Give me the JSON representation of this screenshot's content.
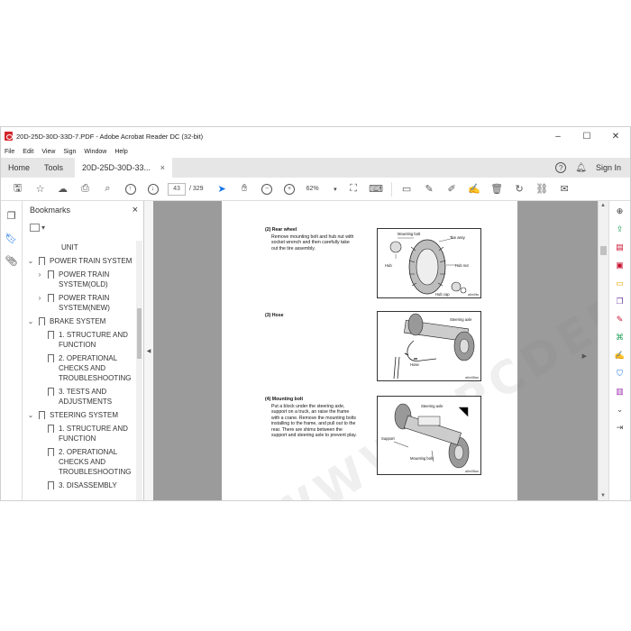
{
  "window": {
    "title": "20D-25D-30D-33D-7.PDF - Adobe Acrobat Reader DC (32-bit)",
    "controls": [
      "–",
      "☐",
      "✕"
    ]
  },
  "menu": [
    "File",
    "Edit",
    "View",
    "Sign",
    "Window",
    "Help"
  ],
  "tabs": {
    "home": "Home",
    "tools": "Tools",
    "doc": "20D-25D-30D-33...",
    "close": "×",
    "signin": "Sign In"
  },
  "toolbar": {
    "page_current": "43",
    "page_total": "/ 329",
    "zoom": "62%"
  },
  "bookmarks": {
    "title": "Bookmarks",
    "close": "×",
    "items": [
      {
        "label": "UNIT",
        "level": 3,
        "expand": "",
        "cut": true
      },
      {
        "label": "POWER TRAIN SYSTEM",
        "level": 1,
        "expand": "⌄"
      },
      {
        "label": "POWER TRAIN SYSTEM(OLD)",
        "level": 2,
        "expand": "›"
      },
      {
        "label": "POWER TRAIN SYSTEM(NEW)",
        "level": 2,
        "expand": "›"
      },
      {
        "label": "BRAKE SYSTEM",
        "level": 1,
        "expand": "⌄"
      },
      {
        "label": "1. STRUCTURE AND FUNCTION",
        "level": 2,
        "expand": ""
      },
      {
        "label": "2. OPERATIONAL CHECKS AND TROUBLESHOOTING",
        "level": 2,
        "expand": ""
      },
      {
        "label": "3. TESTS AND ADJUSTMENTS",
        "level": 2,
        "expand": ""
      },
      {
        "label": "STEERING SYSTEM",
        "level": 1,
        "expand": "⌄"
      },
      {
        "label": "1. STRUCTURE AND FUNCTION",
        "level": 2,
        "expand": ""
      },
      {
        "label": "2. OPERATIONAL CHECKS AND TROUBLESHOOTING",
        "level": 2,
        "expand": ""
      },
      {
        "label": "3. DISASSEMBLY",
        "level": 2,
        "expand": "",
        "cut": true
      }
    ]
  },
  "document": {
    "watermark": "WWW.EPCDEPO.COM",
    "sections": [
      {
        "heading": "(2) Rear wheel",
        "text": "Remove mounting bolt and hub nut with socket wrench and then carefully take out the tire assembly."
      },
      {
        "heading": "(3) Hose",
        "text": ""
      },
      {
        "heading": "(4) Mounting bolt",
        "text": "Put a block under the steering axle, support on a truck, an raise the frame with a crane.  Remove the mounting bolts installing to the frame, and pull out to the rear. There are shims between the support and steering axle to prevent play."
      }
    ],
    "fig1": {
      "labels": [
        "Mounting bolt",
        "Tire assy",
        "Hub",
        "Hub nut",
        "Hub cap"
      ],
      "code": "a6m0lw"
    },
    "fig2": {
      "labels": [
        "Steering axle",
        "Hose"
      ],
      "code": "a6m08ws"
    },
    "fig3": {
      "labels": [
        "Steering axle",
        "Support",
        "Mounting bolt"
      ],
      "code": "a6m08ws"
    }
  },
  "right_tools": [
    {
      "name": "zoom-tool",
      "glyph": "⊕",
      "color": "#333333"
    },
    {
      "name": "export-pdf",
      "glyph": "⇪",
      "color": "#1f9d55"
    },
    {
      "name": "organize-pages",
      "glyph": "▤",
      "color": "#c8102e"
    },
    {
      "name": "create-pdf",
      "glyph": "▣",
      "color": "#c8102e"
    },
    {
      "name": "comment",
      "glyph": "▭",
      "color": "#e8a200"
    },
    {
      "name": "combine-files",
      "glyph": "❐",
      "color": "#6b3fa0"
    },
    {
      "name": "edit-pdf",
      "glyph": "✎",
      "color": "#c8102e"
    },
    {
      "name": "scan-ocr",
      "glyph": "⌘",
      "color": "#1f9d55"
    },
    {
      "name": "fill-sign",
      "glyph": "✍",
      "color": "#9b2fae"
    },
    {
      "name": "protect",
      "glyph": "⛉",
      "color": "#1473e6"
    },
    {
      "name": "request-signature",
      "glyph": "▥",
      "color": "#9b2fae"
    },
    {
      "name": "more-tools",
      "glyph": "⌄",
      "color": "#555555"
    },
    {
      "name": "expand-pane",
      "glyph": "⇥",
      "color": "#555555"
    }
  ]
}
